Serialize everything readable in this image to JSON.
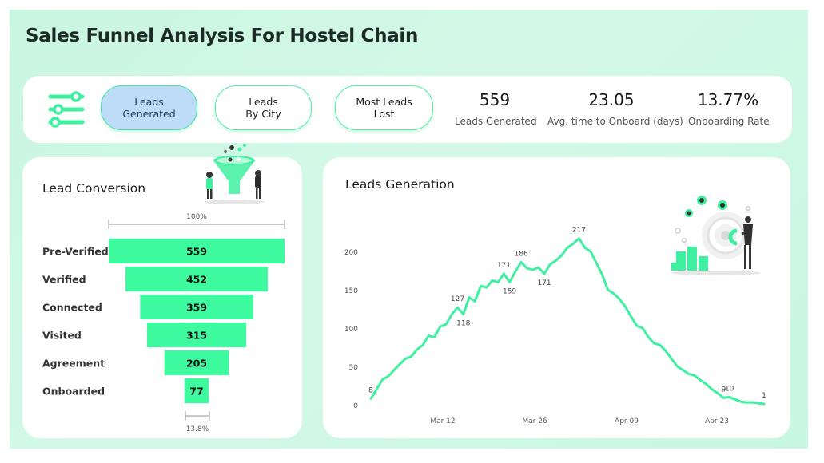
{
  "title": "Sales Funnel Analysis For Hostel Chain",
  "colors": {
    "accent": "#3dfb9e",
    "line": "#3ff0a0",
    "active_tab": "#bcdcf8",
    "background": "#c9f6e0"
  },
  "tabs": [
    {
      "line1": "Leads",
      "line2": "Generated",
      "active": true
    },
    {
      "line1": "Leads",
      "line2": "By City",
      "active": false
    },
    {
      "line1": "Most Leads",
      "line2": "Lost",
      "active": false
    }
  ],
  "kpis": [
    {
      "value": "559",
      "label": "Leads Generated"
    },
    {
      "value": "23.05",
      "label": "Avg. time to Onboard (days)"
    },
    {
      "value": "13.77%",
      "label": "Onboarding Rate"
    }
  ],
  "lead_conversion": {
    "title": "Lead Conversion",
    "top_percent": "100%",
    "bottom_percent": "13.8%"
  },
  "leads_generation": {
    "title": "Leads Generation"
  },
  "icons": [
    "filter-sliders-icon",
    "funnel-illustration",
    "target-magnet-illustration"
  ],
  "chart_data": [
    {
      "type": "bar",
      "subtype": "funnel",
      "categories": [
        "Pre-Verified",
        "Verified",
        "Connected",
        "Visited",
        "Agreement",
        "Onboarded"
      ],
      "values": [
        559,
        452,
        359,
        315,
        205,
        77
      ]
    },
    {
      "type": "line",
      "x_ticks": [
        "Mar 12",
        "Mar 26",
        "Apr 09",
        "Apr 23"
      ],
      "y_ticks": [
        0,
        50,
        100,
        150,
        200
      ],
      "ylim": [
        0,
        217
      ],
      "values": [
        8,
        20,
        33,
        37,
        45,
        53,
        60,
        63,
        72,
        78,
        90,
        88,
        102,
        105,
        118,
        127,
        118,
        140,
        135,
        155,
        153,
        162,
        160,
        171,
        160,
        174,
        186,
        178,
        176,
        179,
        171,
        183,
        188,
        195,
        205,
        210,
        217,
        205,
        200,
        185,
        170,
        150,
        145,
        138,
        128,
        115,
        103,
        100,
        88,
        80,
        78,
        70,
        60,
        50,
        45,
        40,
        38,
        32,
        27,
        20,
        15,
        9,
        10,
        7,
        4,
        3,
        3,
        2,
        1
      ],
      "labels": [
        {
          "index": 0,
          "text": "8"
        },
        {
          "index": 15,
          "text": "127"
        },
        {
          "index": 16,
          "text": "118"
        },
        {
          "index": 23,
          "text": "171"
        },
        {
          "index": 24,
          "text": "159"
        },
        {
          "index": 26,
          "text": "186"
        },
        {
          "index": 30,
          "text": "171"
        },
        {
          "index": 36,
          "text": "217"
        },
        {
          "index": 61,
          "text": "9"
        },
        {
          "index": 62,
          "text": "10"
        },
        {
          "index": 68,
          "text": "1"
        }
      ]
    }
  ]
}
